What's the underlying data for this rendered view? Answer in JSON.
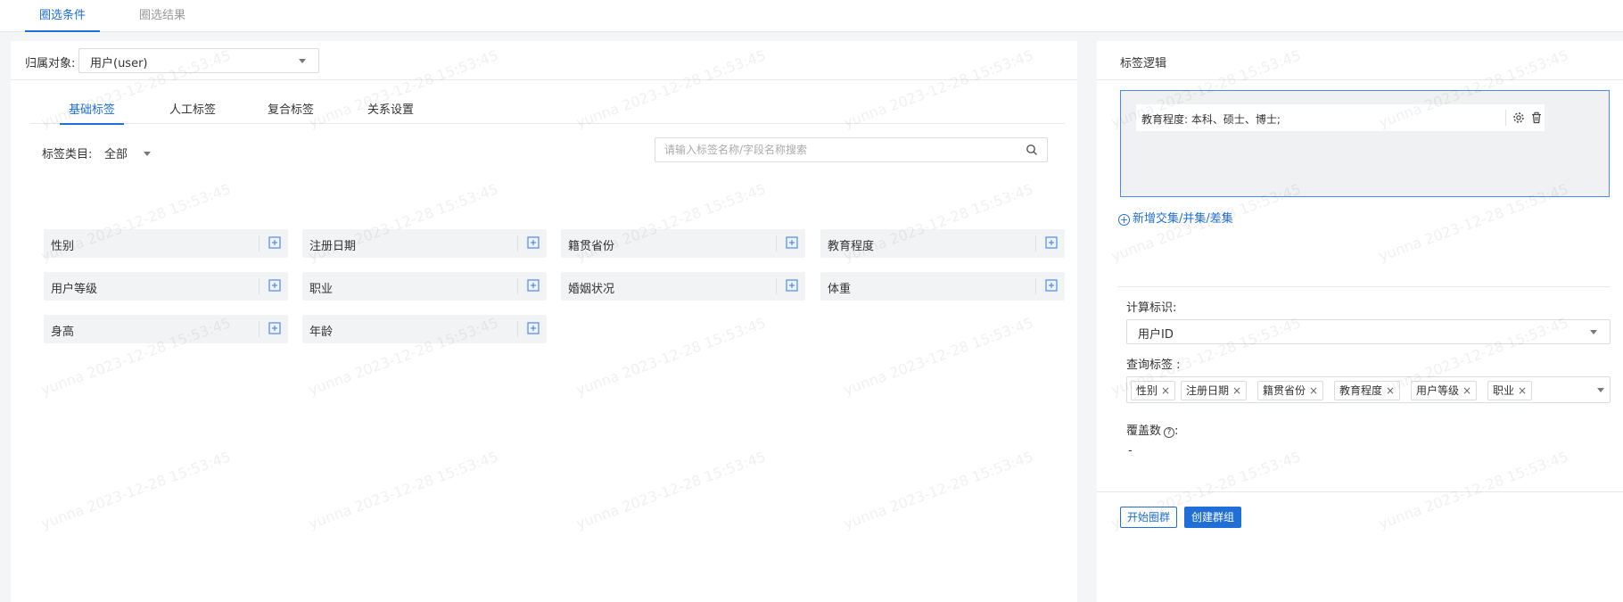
{
  "top_tabs": [
    {
      "label": "圈选条件",
      "active": true
    },
    {
      "label": "圈选结果",
      "active": false
    }
  ],
  "owner": {
    "label": "归属对象:",
    "value": "用户(user)"
  },
  "sub_tabs": [
    {
      "label": "基础标签",
      "active": true
    },
    {
      "label": "人工标签",
      "active": false
    },
    {
      "label": "复合标签",
      "active": false
    },
    {
      "label": "关系设置",
      "active": false
    }
  ],
  "category": {
    "label": "标签类目:",
    "value": "全部"
  },
  "search": {
    "placeholder": "请输入标签名称/字段名称搜索",
    "value": ""
  },
  "tags": [
    "性别",
    "注册日期",
    "籍贯省份",
    "教育程度",
    "用户等级",
    "职业",
    "婚姻状况",
    "体重",
    "身高",
    "年龄"
  ],
  "logic": {
    "title": "标签逻辑",
    "item_text": "教育程度: 本科、硕士、博士;",
    "add_label": "新增交集/并集/差集"
  },
  "calc_id": {
    "label": "计算标识:",
    "value": "用户ID"
  },
  "query_tags": {
    "label": "查询标签 :",
    "chips": [
      "性别",
      "注册日期",
      "籍贯省份",
      "教育程度",
      "用户等级",
      "职业"
    ]
  },
  "coverage": {
    "label": "覆盖数",
    "value": "-"
  },
  "buttons": {
    "start": "开始圈群",
    "create": "创建群组"
  },
  "watermark": "yunna 2023-12-28 15:53:45",
  "colors": {
    "accent": "#1f6fd6",
    "tag_bg": "#f2f3f5",
    "logic_bg": "#f0f1f3"
  }
}
